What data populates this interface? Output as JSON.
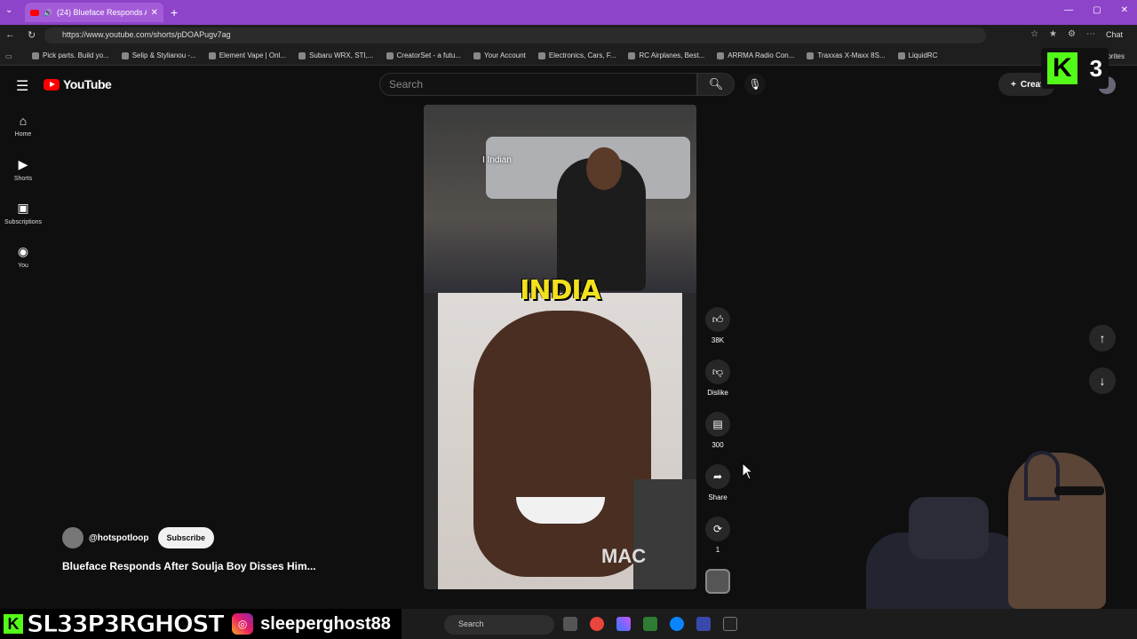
{
  "browser": {
    "tab_title": "(24) Blueface Responds After",
    "url": "https://www.youtube.com/shorts/pDOAPugv7ag",
    "chat_label": "Chat",
    "favorites_label": "orites",
    "bookmarks": [
      "Pick parts. Build yo...",
      "Selip & Stylianou -...",
      "Element Vape | Onl...",
      "Subaru WRX, STI,...",
      "CreatorSet - a futu...",
      "Your Account",
      "Electronics, Cars, F...",
      "RC Airplanes, Best...",
      "ARRMA Radio Con...",
      "Traxxas X-Maxx 8S...",
      "LiquidRC"
    ]
  },
  "youtube": {
    "logo_text": "YouTube",
    "search_placeholder": "Search",
    "create_label": "Creat",
    "sidebar": [
      {
        "icon": "home-icon",
        "glyph": "⌂",
        "label": "Home"
      },
      {
        "icon": "shorts-icon",
        "glyph": "▶",
        "label": "Shorts"
      },
      {
        "icon": "subscriptions-icon",
        "glyph": "▣",
        "label": "Subscriptions"
      },
      {
        "icon": "you-icon",
        "glyph": "◉",
        "label": "You"
      }
    ]
  },
  "video": {
    "caption": "I Indian",
    "overlay_text": "INDIA",
    "corner_text": "MAC"
  },
  "actions": {
    "like_count": "38K",
    "dislike_label": "Dislike",
    "comment_count": "300",
    "share_label": "Share",
    "remix_count": "1"
  },
  "short": {
    "channel": "@hotspotloop",
    "subscribe_label": "Subscribe",
    "title": "Blueface Responds After Soulja Boy Disses Him..."
  },
  "overlay": {
    "kick_viewers": "3",
    "stream_name": "SL33P3RGHOST",
    "instagram_handle": "sleeperghost88",
    "kick_color": "#53fc18"
  },
  "taskbar": {
    "search_label": "Search"
  }
}
